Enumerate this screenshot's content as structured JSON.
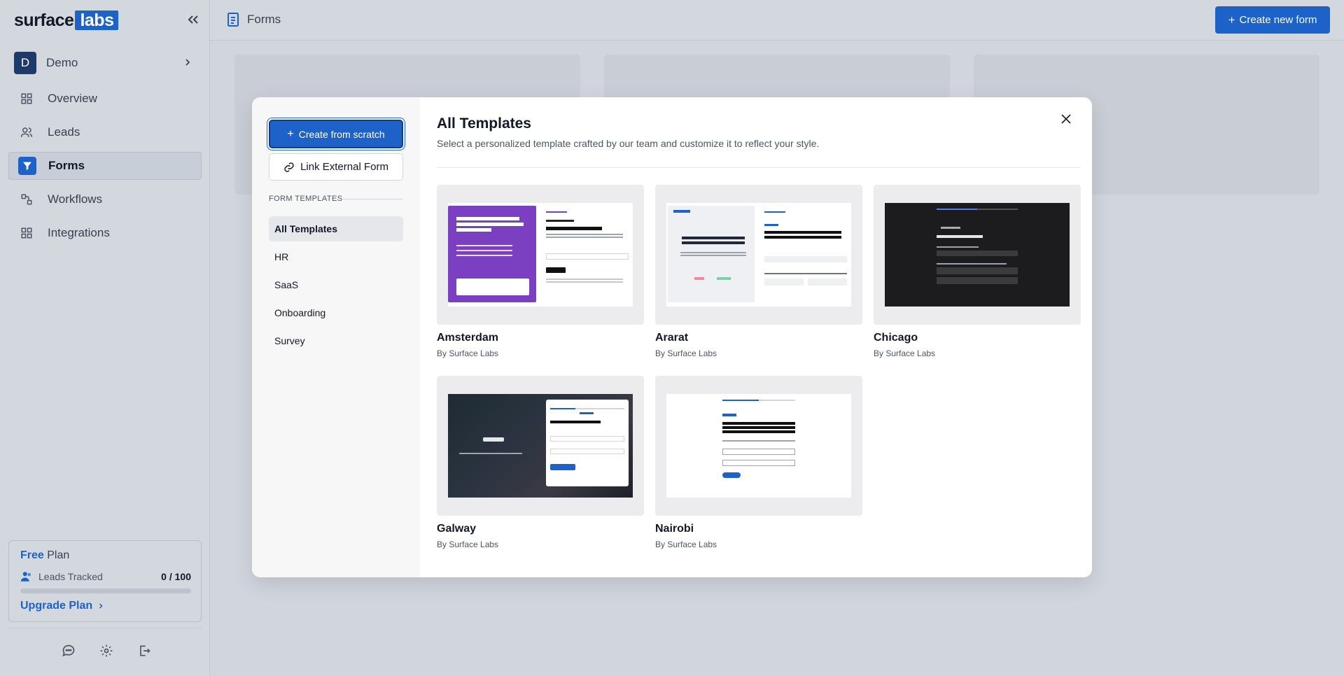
{
  "sidebar": {
    "logo_text": "surface",
    "logo_badge": "labs",
    "workspace": {
      "initial": "D",
      "name": "Demo"
    },
    "items": [
      {
        "label": "Overview",
        "icon": "grid-icon"
      },
      {
        "label": "Leads",
        "icon": "users-icon"
      },
      {
        "label": "Forms",
        "icon": "filter-icon",
        "active": true
      },
      {
        "label": "Workflows",
        "icon": "workflow-icon"
      },
      {
        "label": "Integrations",
        "icon": "grid-icon"
      }
    ],
    "plan": {
      "name": "Free",
      "suffix": "Plan",
      "leads_label": "Leads Tracked",
      "leads_count": "0 / 100",
      "progress": 0,
      "upgrade_label": "Upgrade Plan"
    }
  },
  "header": {
    "title": "Forms",
    "create_button": "Create new form"
  },
  "modal": {
    "create_scratch": "Create from scratch",
    "link_external": "Link External Form",
    "section_label": "FORM TEMPLATES",
    "categories": [
      "All Templates",
      "HR",
      "SaaS",
      "Onboarding",
      "Survey"
    ],
    "title": "All Templates",
    "subtitle": "Select a personalized template crafted by our team and customize it to reflect your style.",
    "templates": [
      {
        "name": "Amsterdam",
        "by": "By Surface Labs"
      },
      {
        "name": "Ararat",
        "by": "By Surface Labs"
      },
      {
        "name": "Chicago",
        "by": "By Surface Labs"
      },
      {
        "name": "Galway",
        "by": "By Surface Labs"
      },
      {
        "name": "Nairobi",
        "by": "By Surface Labs"
      }
    ]
  },
  "colors": {
    "accent": "#1c62c9",
    "sidebar_bg": "#d3d7de",
    "modal_bg": "#ffffff"
  }
}
